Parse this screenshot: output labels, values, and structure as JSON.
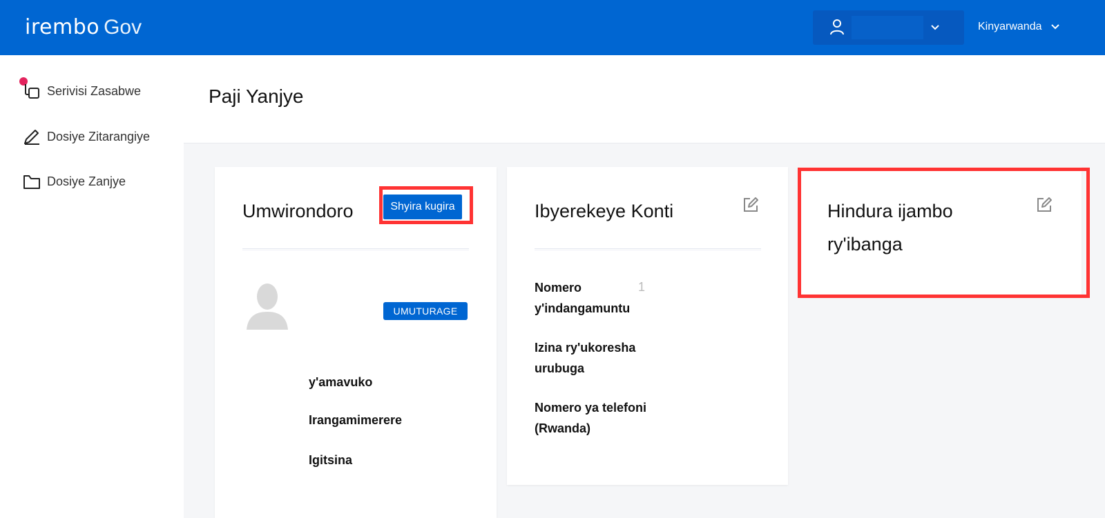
{
  "header": {
    "logo_main": "irembo",
    "logo_sub": "Gov",
    "language": "Kinyarwanda"
  },
  "sidebar": {
    "items": [
      {
        "label": "Serivisi Zasabwe",
        "icon": "copy-icon"
      },
      {
        "label": "Dosiye Zitarangiye",
        "icon": "pen-icon"
      },
      {
        "label": "Dosiye Zanjye",
        "icon": "folder-icon"
      }
    ]
  },
  "page": {
    "title": "Paji Yanjye"
  },
  "profile_card": {
    "title": "Umwirondoro",
    "update_button": "Shyira kugira",
    "role_badge": "UMUTURAGE",
    "fields": [
      "y'amavuko",
      "Irangamimerere",
      "Igitsina"
    ]
  },
  "account_card": {
    "title": "Ibyerekeye Konti",
    "fields": [
      {
        "label_line1": "Nomero",
        "label_line2": "y'indangamuntu",
        "value": "1"
      },
      {
        "label_line1": "Izina ry'ukoresha",
        "label_line2": "urubuga",
        "value": ""
      },
      {
        "label_line1": "Nomero ya telefoni",
        "label_line2": "(Rwanda)",
        "value": ""
      }
    ]
  },
  "password_card": {
    "title_line1": "Hindura ijambo",
    "title_line2": "ry'ibanga"
  },
  "colors": {
    "brand_blue": "#0066d2",
    "highlight_red": "#ff3333",
    "notification_pink": "#e3235d"
  }
}
